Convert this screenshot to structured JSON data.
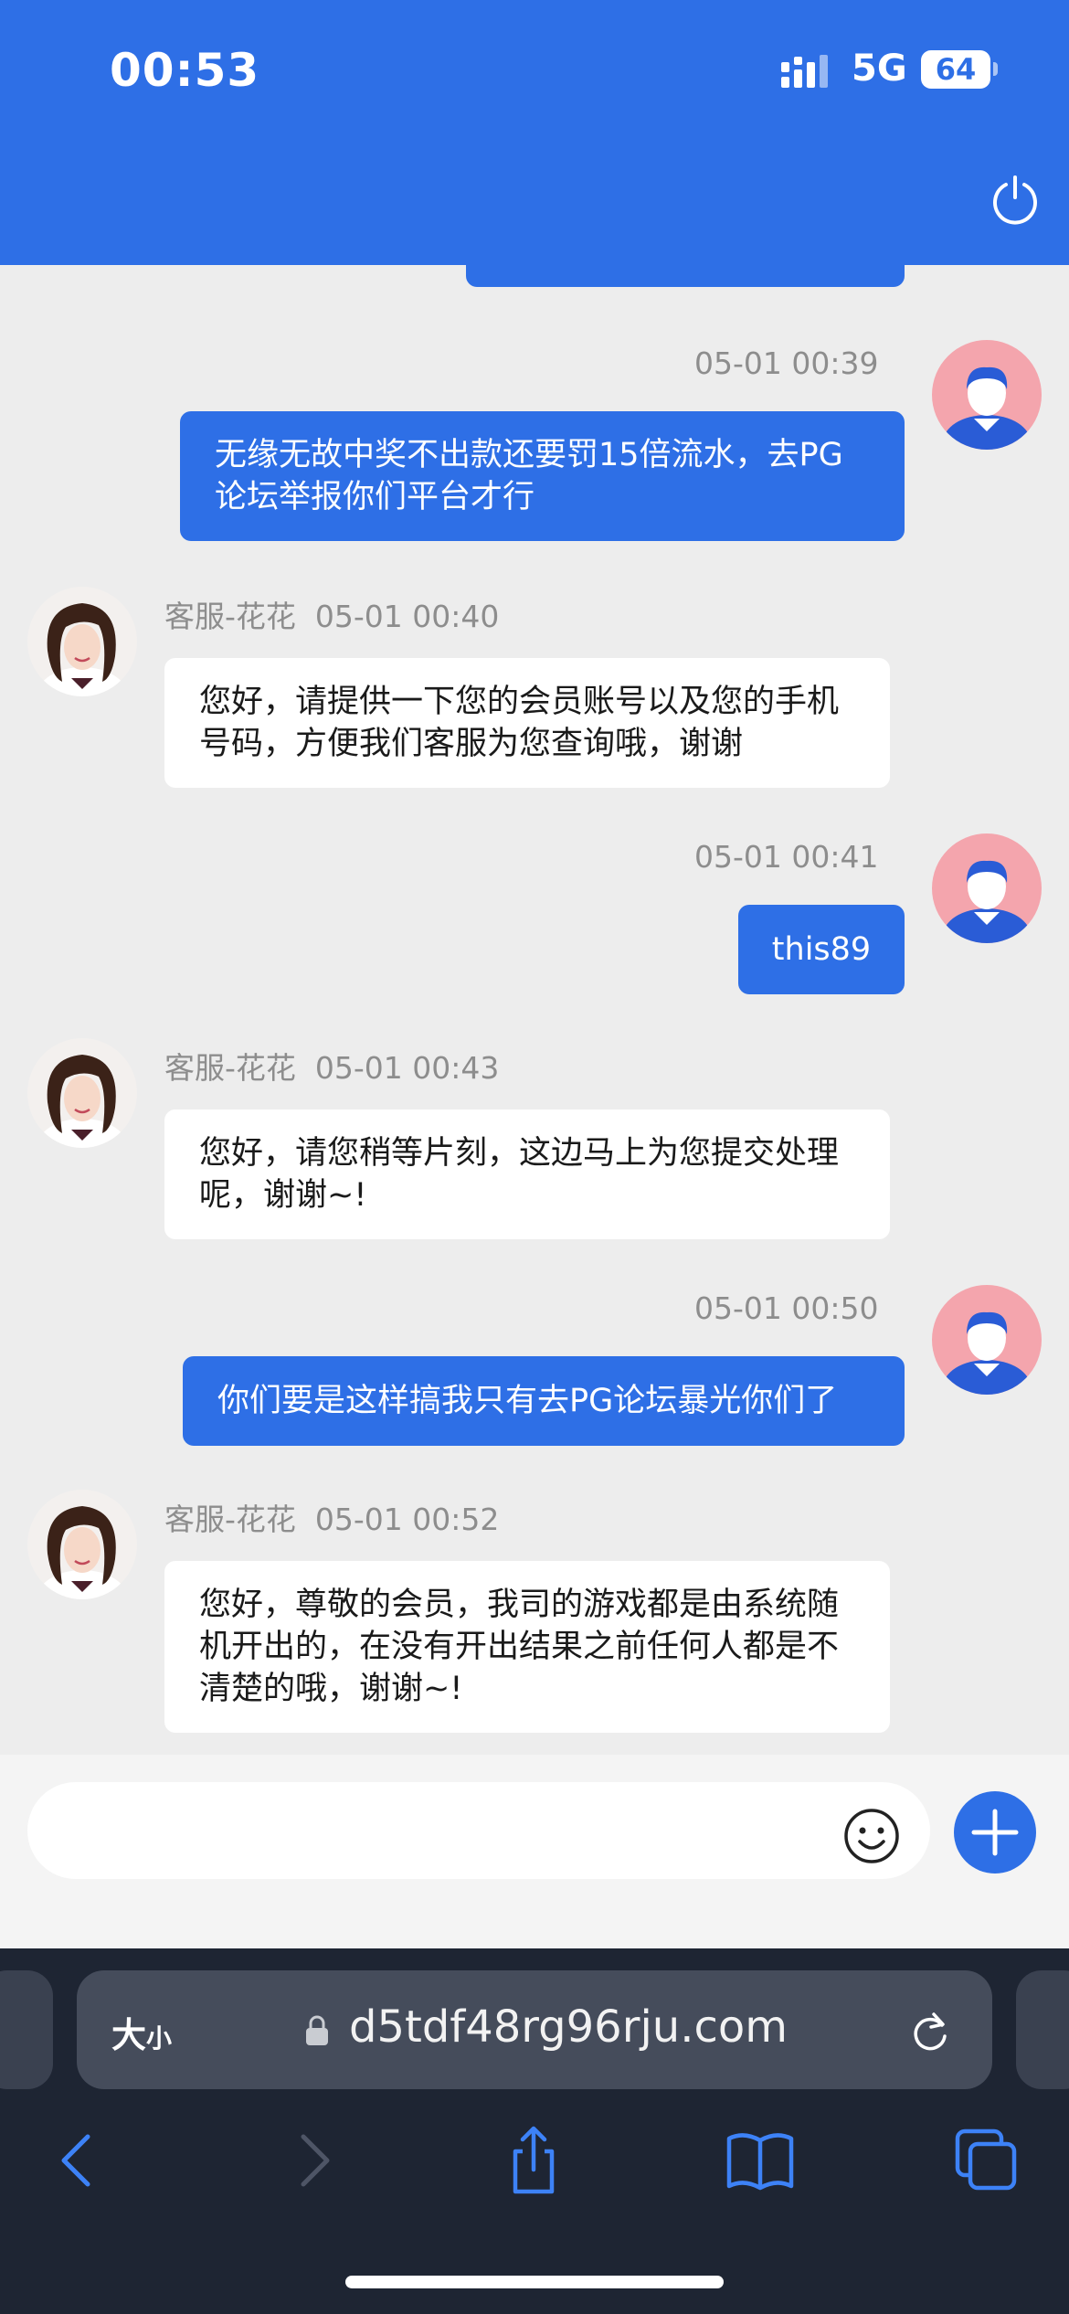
{
  "status_bar": {
    "time": "00:53",
    "network": "5G",
    "battery": "64"
  },
  "header": {
    "power_icon": "power-icon"
  },
  "messages": [
    {
      "sender": "me",
      "time": "05-01 00:39",
      "text": "无缘无故中奖不出款还要罚15倍流水，去PG论坛举报你们平台才行"
    },
    {
      "sender": "agent",
      "name": "客服-花花",
      "time": "05-01 00:40",
      "text": "您好，请提供一下您的会员账号以及您的手机号码，方便我们客服为您查询哦，谢谢"
    },
    {
      "sender": "me",
      "time": "05-01 00:41",
      "text": "this89"
    },
    {
      "sender": "agent",
      "name": "客服-花花",
      "time": "05-01 00:43",
      "text": "您好，请您稍等片刻，这边马上为您提交处理呢，谢谢~!"
    },
    {
      "sender": "me",
      "time": "05-01 00:50",
      "text": "你们要是这样搞我只有去PG论坛暴光你们了"
    },
    {
      "sender": "agent",
      "name": "客服-花花",
      "time": "05-01 00:52",
      "text": "您好，尊敬的会员，我司的游戏都是由系统随机开出的，在没有开出结果之前任何人都是不清楚的哦，谢谢~!"
    }
  ],
  "input": {
    "placeholder": "",
    "emoji_icon": "emoji-icon",
    "plus_icon": "plus-icon"
  },
  "browser": {
    "text_size_label": "大",
    "text_size_small": "小",
    "url": "d5tdf48rg96rju.com"
  },
  "colors": {
    "accent": "#2e6fe6",
    "chat_bg": "#ededed",
    "toolbar_bg": "#1e2533"
  }
}
